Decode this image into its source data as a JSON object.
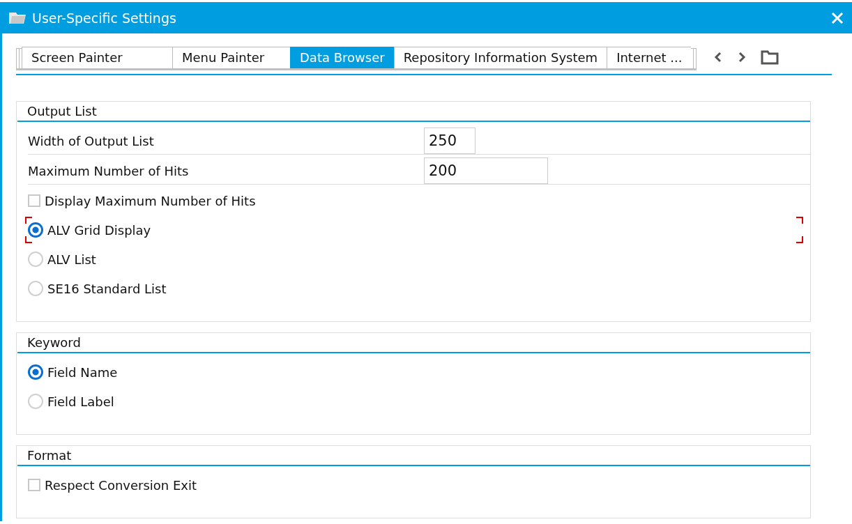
{
  "dialog": {
    "title": "User-Specific Settings"
  },
  "tabs": [
    {
      "label": "Screen Painter",
      "selected": false
    },
    {
      "label": "Menu Painter",
      "selected": false
    },
    {
      "label": "Data Browser",
      "selected": true
    },
    {
      "label": "Repository Information System",
      "selected": false
    },
    {
      "label": "Internet ...",
      "selected": false
    }
  ],
  "groups": [
    {
      "title": "Output List",
      "items": [
        {
          "kind": "shortfield",
          "label": "Width of Output List",
          "value": "250"
        },
        {
          "kind": "field",
          "label": "Maximum Number of Hits",
          "value": "200"
        },
        {
          "kind": "checkbox",
          "label": "Display Maximum Number of Hits",
          "checked": false,
          "focused": false
        },
        {
          "kind": "radio",
          "label": "ALV Grid Display",
          "selected": true,
          "focused": true
        },
        {
          "kind": "radio",
          "label": "ALV List",
          "selected": false,
          "focused": false
        },
        {
          "kind": "radio",
          "label": "SE16 Standard List",
          "selected": false,
          "focused": false
        }
      ]
    },
    {
      "title": "Keyword",
      "items": [
        {
          "kind": "radio",
          "label": "Field Name",
          "selected": true,
          "focused": false
        },
        {
          "kind": "radio",
          "label": "Field Label",
          "selected": false,
          "focused": false
        }
      ]
    },
    {
      "title": "Format",
      "items": [
        {
          "kind": "checkbox",
          "label": "Respect Conversion Exit",
          "checked": false,
          "focused": false
        }
      ]
    }
  ]
}
